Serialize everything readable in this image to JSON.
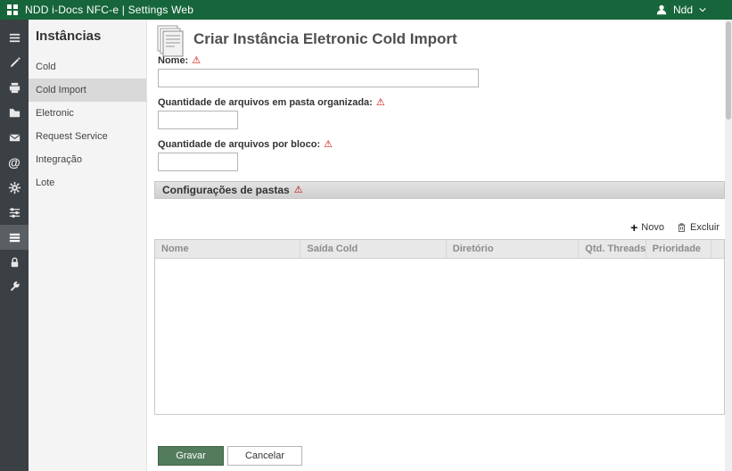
{
  "topbar": {
    "title": "NDD i-Docs NFC-e | Settings Web",
    "user": "Ndd"
  },
  "icon_rail": {
    "icons": [
      "menu",
      "design",
      "printer",
      "folders",
      "mail",
      "email-at",
      "settings",
      "preferences",
      "instances",
      "security",
      "tools"
    ],
    "active": "instances"
  },
  "sidebar": {
    "title": "Instâncias",
    "items": [
      {
        "label": "Cold",
        "selected": false
      },
      {
        "label": "Cold Import",
        "selected": true
      },
      {
        "label": "Eletronic",
        "selected": false
      },
      {
        "label": "Request Service",
        "selected": false
      },
      {
        "label": "Integração",
        "selected": false
      },
      {
        "label": "Lote",
        "selected": false
      }
    ]
  },
  "main": {
    "title": "Criar Instância Eletronic Cold Import",
    "fields": [
      {
        "label": "Nome:",
        "value": "",
        "required": true
      },
      {
        "label": "Quantidade de arquivos em pasta organizada:",
        "value": "",
        "required": true
      },
      {
        "label": "Quantidade de arquivos por bloco:",
        "value": "",
        "required": true
      }
    ],
    "folders_section": {
      "title": "Configurações de pastas",
      "toolbar": {
        "novo": "Novo",
        "excluir": "Excluir"
      },
      "table": {
        "headers": [
          "Nome",
          "Saída Cold",
          "Diretório",
          "Qtd. Threads",
          "Prioridade"
        ],
        "rows": []
      }
    },
    "actions": {
      "save": "Gravar",
      "cancel": "Cancelar"
    }
  },
  "icons": {
    "warning": "⚠",
    "plus": "+"
  },
  "colors": {
    "topbar_green": "#17663b",
    "button_green": "#527c5c",
    "warning_red": "#cc0000",
    "rail_dark": "#3b4045"
  }
}
